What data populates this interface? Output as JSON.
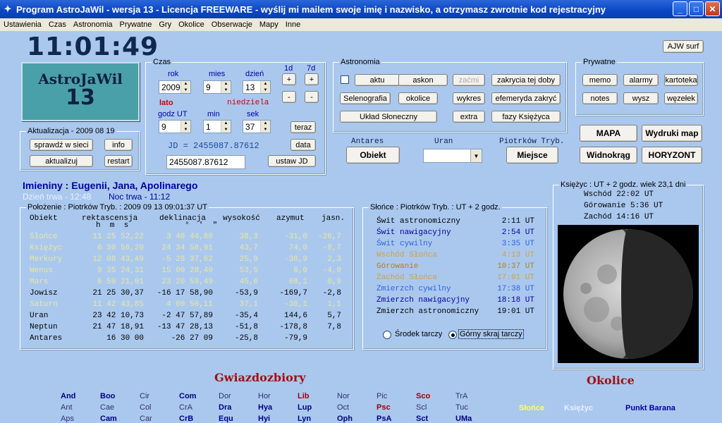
{
  "window": {
    "title": "Program AstroJaWil - wersja 13 - Licencja FREEWARE - wyślij mi mailem swoje imię i nazwisko, a otrzymasz zwrotnie kod rejestracyjny",
    "icon": "star-icon"
  },
  "menu": [
    "Ustawienia",
    "Czas",
    "Astronomia",
    "Prywatne",
    "Gry",
    "Okolice",
    "Obserwacje",
    "Mapy",
    "Inne"
  ],
  "clock": "11:01:49",
  "logo": {
    "line1": "AstroJaWil",
    "line2": "13"
  },
  "ajw_surf": "AJW surf",
  "aktualizacja": {
    "title": "Aktualizacja - 2009 08 19",
    "check": "sprawdź w sieci",
    "info": "info",
    "update": "aktualizuj",
    "restart": "restart"
  },
  "czas": {
    "title": "Czas",
    "rok_label": "rok",
    "mies_label": "mies",
    "dzien_label": "dzień",
    "rok": "2009",
    "mies": "9",
    "dzien": "13",
    "lato": "lato",
    "weekday": "niedziela",
    "godz_label": "godz UT",
    "min_label": "min",
    "sek_label": "sek",
    "godz": "9",
    "min": "1",
    "sek": "37",
    "d1": "1d",
    "d7": "7d",
    "plus": "+",
    "minus": "-",
    "teraz": "teraz",
    "data": "data",
    "jd_text": "JD = 2455087.87612",
    "jd_value": "2455087.87612",
    "ustaw": "ustaw JD"
  },
  "astronomia": {
    "title": "Astronomia",
    "aktu": "aktu",
    "askon": "askon",
    "zacmi": "zaćmi",
    "zakrycia": "zakrycia tej doby",
    "selenografia": "Selenografia",
    "okolice": "okolice",
    "wykres": "wykres",
    "efemeryda": "efemeryda zakryć",
    "uklad": "Układ Słoneczny",
    "extra": "extra",
    "fazy": "fazy Księżyca"
  },
  "prywatne": {
    "title": "Prywatne",
    "memo": "memo",
    "alarmy": "alarmy",
    "kartoteka": "kartoteka",
    "notes": "notes",
    "wysz": "wysz",
    "wezelek": "węzełek"
  },
  "right_buttons": {
    "mapa": "MAPA",
    "wydruki": "Wydruki map",
    "widnokrag": "Widnokrąg",
    "horyzont": "HORYZONT"
  },
  "selectors": {
    "antares": "Antares",
    "obiekt": "Obiekt",
    "uran": "Uran",
    "piotrkow": "Piotrków Tryb.",
    "miejsce": "Miejsce"
  },
  "imieniny": "Imieniny : Eugenii, Jana, Apolinarego",
  "dzien_trwa": "Dzień trwa - 12:48",
  "noc_trwa": "Noc trwa - 11:12",
  "polozenie": {
    "title": "Położenie : Piotrków Tryb. : 2009 09 13   09:01:37 UT",
    "headers": [
      "Obiekt",
      "rektascensja",
      "deklinacja",
      "wysokość",
      "azymut",
      "jasn."
    ],
    "subheaders": {
      "ra": "h  m  s",
      "dec": "°  '  \""
    },
    "rows": [
      {
        "name": "Słońce",
        "ra": "11 25 52,22",
        "dec": "3 40 44,80",
        "alt": "38,3",
        "az": "-31,0",
        "mag": "-26,7",
        "color": "#e8e8a0"
      },
      {
        "name": "Księżyc",
        "ra": "6 30 56,20",
        "dec": "24 34 58,91",
        "alt": "43,7",
        "az": "74,0",
        "mag": "-8,7",
        "color": "#e8e8a0"
      },
      {
        "name": "Merkury",
        "ra": "12 08 43,49",
        "dec": "-5 28 37,62",
        "alt": "25,9",
        "az": "-38,9",
        "mag": "2,3",
        "color": "#e8e8a0"
      },
      {
        "name": "Wenus",
        "ra": "9 35 24,31",
        "dec": "15 00 28,40",
        "alt": "53,5",
        "az": "6,0",
        "mag": "-4,0",
        "color": "#e8e8a0"
      },
      {
        "name": "Mars",
        "ra": "6 50 21,01",
        "dec": "23 20 59,49",
        "alt": "45,6",
        "az": "68,1",
        "mag": "0,9",
        "color": "#e8e8a0"
      },
      {
        "name": "Jowisz",
        "ra": "21 25 30,37",
        "dec": "-16 17 58,90",
        "alt": "-53,9",
        "az": "-169,7",
        "mag": "-2,8",
        "color": "#000"
      },
      {
        "name": "Saturn",
        "ra": "11 42 43,85",
        "dec": "4 00 50,11",
        "alt": "37,1",
        "az": "-36,1",
        "mag": "1,1",
        "color": "#e8e8a0"
      },
      {
        "name": "Uran",
        "ra": "23 42 10,73",
        "dec": "-2 47 57,89",
        "alt": "-35,4",
        "az": "144,6",
        "mag": "5,7",
        "color": "#000"
      },
      {
        "name": "Neptun",
        "ra": "21 47 18,91",
        "dec": "-13 47 28,13",
        "alt": "-51,8",
        "az": "-178,8",
        "mag": "7,8",
        "color": "#000"
      },
      {
        "name": "Antares",
        "ra": "16 30 00",
        "dec": "-26 27 09",
        "alt": "-25,8",
        "az": "-79,9",
        "mag": "",
        "color": "#000"
      }
    ]
  },
  "slonce": {
    "title": "Słońce : Piotrków Tryb. : UT + 2 godz.",
    "rows": [
      {
        "label": "Świt astronomiczny",
        "time": "2:11 UT",
        "color": "#000"
      },
      {
        "label": "Świt nawigacyjny",
        "time": "2:54 UT",
        "color": "#0000a0"
      },
      {
        "label": "Świt cywilny",
        "time": "3:35 UT",
        "color": "#3060e0"
      },
      {
        "label": "Wschód Słońca",
        "time": "4:13 UT",
        "color": "#d0a040"
      },
      {
        "label": "Górowanie",
        "time": "10:37 UT",
        "color": "#b08020"
      },
      {
        "label": "Zachód Słońca",
        "time": "17:01 UT",
        "color": "#d0a040"
      },
      {
        "label": "Zmierzch cywilny",
        "time": "17:38 UT",
        "color": "#3060e0"
      },
      {
        "label": "Zmierzch nawigacyjny",
        "time": "18:18 UT",
        "color": "#0000a0"
      },
      {
        "label": "Zmierzch astronomiczny",
        "time": "19:01 UT",
        "color": "#000"
      }
    ],
    "srodek": "Środek tarczy",
    "gorny": "Górny skraj tarczy"
  },
  "ksiezyc": {
    "title": "Księżyc : UT + 2 godz.   wiek 23,1 dni",
    "wschod": "Wschód     22:02 UT",
    "gorowanie": "Górowanie   5:36 UT",
    "zachod": "Zachód     14:16 UT",
    "illumination": 0.55
  },
  "gwiazdozbiory_title": "Gwiazdozbiory",
  "okolice_title": "Okolice",
  "constellations": [
    [
      "And",
      "Boo",
      "Cir",
      "Com",
      "Dor",
      "Hor",
      "Lib",
      "Nor",
      "Pic",
      "Sco",
      "TrA"
    ],
    [
      "Ant",
      "Cae",
      "Col",
      "CrA",
      "Dra",
      "Hya",
      "Lup",
      "Oct",
      "Psc",
      "Scl",
      "Tuc"
    ],
    [
      "Aps",
      "Cam",
      "Car",
      "CrB",
      "Equ",
      "Hyi",
      "Lyn",
      "Oph",
      "PsA",
      "Sct",
      "UMa"
    ]
  ],
  "const_colors": [
    [
      "#000080",
      "#000080",
      "#303070",
      "#000080",
      "#303070",
      "#303070",
      "#a00000",
      "#303070",
      "#303070",
      "#a00000",
      "#303070"
    ],
    [
      "#303070",
      "#303070",
      "#303070",
      "#303070",
      "#000080",
      "#000080",
      "#000080",
      "#303070",
      "#a00000",
      "#303070",
      "#303070"
    ],
    [
      "#303070",
      "#000080",
      "#303070",
      "#000080",
      "#000080",
      "#000080",
      "#000080",
      "#000080",
      "#000080",
      "#000080",
      "#000080"
    ]
  ],
  "okolice_items": {
    "slonce": "Słońce",
    "ksiezyc": "Księżyc",
    "punkt": "Punkt Barana"
  }
}
